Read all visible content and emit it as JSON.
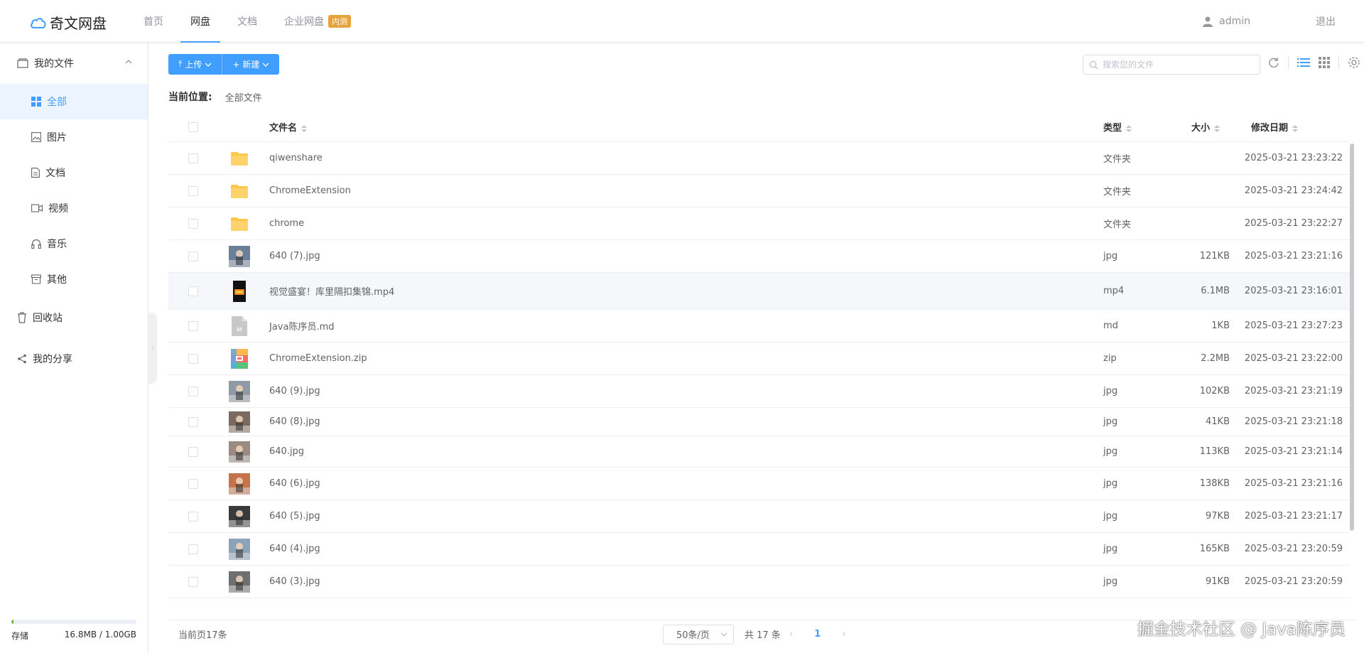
{
  "app": {
    "logo_text": "奇文网盘",
    "nav": [
      {
        "label": "首页",
        "active": false
      },
      {
        "label": "网盘",
        "active": true
      },
      {
        "label": "文档",
        "active": false
      },
      {
        "label": "企业网盘",
        "active": false,
        "badge": "内测"
      }
    ],
    "user_name": "admin",
    "logout_label": "退出"
  },
  "sidebar": {
    "my_files_label": "我的文件",
    "items": [
      {
        "label": "全部",
        "icon": "grid-icon",
        "active": true
      },
      {
        "label": "图片",
        "icon": "image-icon",
        "active": false
      },
      {
        "label": "文档",
        "icon": "document-icon",
        "active": false
      },
      {
        "label": "视频",
        "icon": "video-icon",
        "active": false
      },
      {
        "label": "音乐",
        "icon": "headphones-icon",
        "active": false
      },
      {
        "label": "其他",
        "icon": "archive-icon",
        "active": false
      }
    ],
    "recycle_label": "回收站",
    "share_label": "我的分享",
    "storage": {
      "label": "存储",
      "usage": "16.8MB / 1.00GB",
      "used_fraction": 0.016
    }
  },
  "toolbar": {
    "upload_label": "上传",
    "new_label": "新建",
    "search_placeholder": "搜索您的文件"
  },
  "path": {
    "label": "当前位置:",
    "value": "全部文件"
  },
  "table": {
    "headers": {
      "name": "文件名",
      "type": "类型",
      "size": "大小",
      "date": "修改日期"
    },
    "rows": [
      {
        "name": "qiwenshare",
        "type": "文件夹",
        "size": "",
        "date": "2025-03-21 23:23:22",
        "kind": "folder"
      },
      {
        "name": "ChromeExtension",
        "type": "文件夹",
        "size": "",
        "date": "2025-03-21 23:24:42",
        "kind": "folder"
      },
      {
        "name": "chrome",
        "type": "文件夹",
        "size": "",
        "date": "2025-03-21 23:22:27",
        "kind": "folder"
      },
      {
        "name": "640 (7).jpg",
        "type": "jpg",
        "size": "121KB",
        "date": "2025-03-21 23:21:16",
        "kind": "image",
        "thumb_color": "#6b7f99"
      },
      {
        "name": "视觉盛宴！库里隔扣集锦.mp4",
        "type": "mp4",
        "size": "6.1MB",
        "date": "2025-03-21 23:16:01",
        "kind": "video"
      },
      {
        "name": "Java陈序员.md",
        "type": "md",
        "size": "1KB",
        "date": "2025-03-21 23:27:23",
        "kind": "md"
      },
      {
        "name": "ChromeExtension.zip",
        "type": "zip",
        "size": "2.2MB",
        "date": "2025-03-21 23:22:00",
        "kind": "zip"
      },
      {
        "name": "640 (9).jpg",
        "type": "jpg",
        "size": "102KB",
        "date": "2025-03-21 23:21:19",
        "kind": "image",
        "thumb_color": "#8f9aa5"
      },
      {
        "name": "640 (8).jpg",
        "type": "jpg",
        "size": "41KB",
        "date": "2025-03-21 23:21:18",
        "kind": "image",
        "thumb_color": "#7a6a60"
      },
      {
        "name": "640.jpg",
        "type": "jpg",
        "size": "113KB",
        "date": "2025-03-21 23:21:14",
        "kind": "image",
        "thumb_color": "#9b8a82"
      },
      {
        "name": "640 (6).jpg",
        "type": "jpg",
        "size": "138KB",
        "date": "2025-03-21 23:21:16",
        "kind": "image",
        "thumb_color": "#c4734a"
      },
      {
        "name": "640 (5).jpg",
        "type": "jpg",
        "size": "97KB",
        "date": "2025-03-21 23:21:17",
        "kind": "image",
        "thumb_color": "#3a3a3a"
      },
      {
        "name": "640 (4).jpg",
        "type": "jpg",
        "size": "165KB",
        "date": "2025-03-21 23:20:59",
        "kind": "image",
        "thumb_color": "#8ea3b8"
      },
      {
        "name": "640 (3).jpg",
        "type": "jpg",
        "size": "91KB",
        "date": "2025-03-21 23:20:59",
        "kind": "image",
        "thumb_color": "#6f6f6f"
      }
    ]
  },
  "footer": {
    "page_count": "当前页17条",
    "page_size": "50条/页",
    "total": "共 17 条",
    "current_page": "1"
  },
  "watermark": "掘金技术社区 @ Java陈序员",
  "colors": {
    "primary": "#409eff",
    "folder": "#ffc84d",
    "badge": "#e6a23c"
  }
}
